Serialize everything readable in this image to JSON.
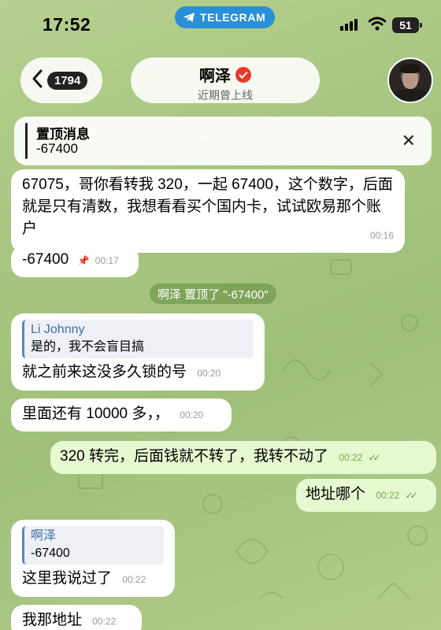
{
  "status_bar": {
    "time": "17:52",
    "app_pill": "TELEGRAM",
    "battery": "51"
  },
  "header": {
    "back_count": "1794",
    "chat_name": "啊泽",
    "chat_status": "近期曾上线"
  },
  "pinned": {
    "title": "置顶消息",
    "text": "-67400"
  },
  "messages": [
    {
      "dir": "in",
      "text": "67075，哥你看转我 320，一起 67400，这个数字，后面就是只有清数，我想看看买个国内卡，试试欧易那个账户",
      "time": "00:16"
    },
    {
      "dir": "in",
      "text": "-67400",
      "time": "00:17",
      "pinned_icon": "pin-icon"
    },
    {
      "dir": "in",
      "reply_name": "Li Johnny",
      "reply_text": "是的，我不会盲目搞",
      "text": "就之前来这没多久锁的号",
      "time": "00:20"
    },
    {
      "dir": "in",
      "text": "里面还有 10000 多，，",
      "time": "00:20"
    },
    {
      "dir": "out",
      "text": "320 转完，后面钱就不转了，我转不动了",
      "time": "00:22"
    },
    {
      "dir": "out",
      "text": "地址哪个",
      "time": "00:22"
    },
    {
      "dir": "in",
      "reply_name": "啊泽",
      "reply_text": "-67400",
      "text": "这里我说过了",
      "time": "00:22"
    },
    {
      "dir": "in",
      "text": "我那地址",
      "time": "00:22"
    }
  ],
  "service_message": "啊泽 置顶了 \"-67400\"",
  "colors": {
    "background": "#a7c57f",
    "outgoing_bubble": "#e6f8cf",
    "incoming_bubble": "#ffffff",
    "telegram_blue": "#2a8fd9",
    "reply_accent": "#3f6ea7",
    "read_tick": "#5aa83a"
  }
}
